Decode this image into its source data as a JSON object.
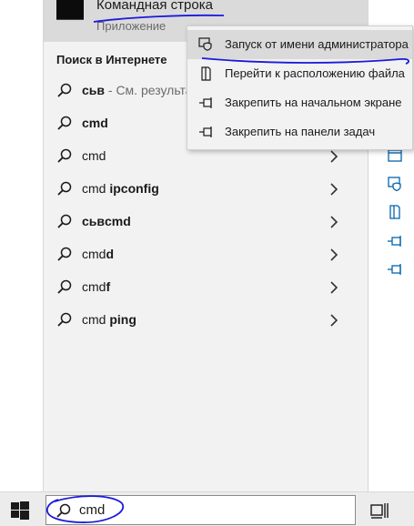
{
  "best_match": {
    "title": "Командная строка",
    "subtitle": "Приложение"
  },
  "web_section": {
    "title": "Поиск в Интернете",
    "results": [
      {
        "bold": "сьв",
        "normal": "",
        "suffix": " - См. результат",
        "chevron": false
      },
      {
        "bold": "cmd",
        "normal": "",
        "suffix": "",
        "chevron": false
      },
      {
        "bold": "",
        "normal": "cmd",
        "suffix": "",
        "chevron": true
      },
      {
        "bold": "ipconfig",
        "normal": "cmd ",
        "suffix": "",
        "chevron": true
      },
      {
        "bold": "сьвcmd",
        "normal": "",
        "suffix": "",
        "chevron": true
      },
      {
        "bold": "d",
        "normal": "cmd",
        "suffix": "",
        "chevron": true
      },
      {
        "bold": "f",
        "normal": "cmd",
        "suffix": "",
        "chevron": true
      },
      {
        "bold": "ping",
        "normal": "cmd ",
        "suffix": "",
        "chevron": true
      }
    ]
  },
  "context_menu": {
    "items": [
      {
        "label": "Запуск от имени администратора",
        "icon": "shield-icon"
      },
      {
        "label": "Перейти к расположению файла",
        "icon": "folder-icon"
      },
      {
        "label": "Закрепить на начальном экране",
        "icon": "pin-icon"
      },
      {
        "label": "Закрепить на панели задач",
        "icon": "pin-icon"
      }
    ]
  },
  "side_actions": [
    "shield-icon",
    "folder-icon",
    "pin-icon",
    "pin-icon"
  ],
  "taskbar": {
    "search_value": "cmd"
  },
  "colors": {
    "panel_bg": "#f2f2f2",
    "highlight_bg": "#dadada",
    "accent": "#0063b1",
    "annotation": "#1a1adc"
  }
}
